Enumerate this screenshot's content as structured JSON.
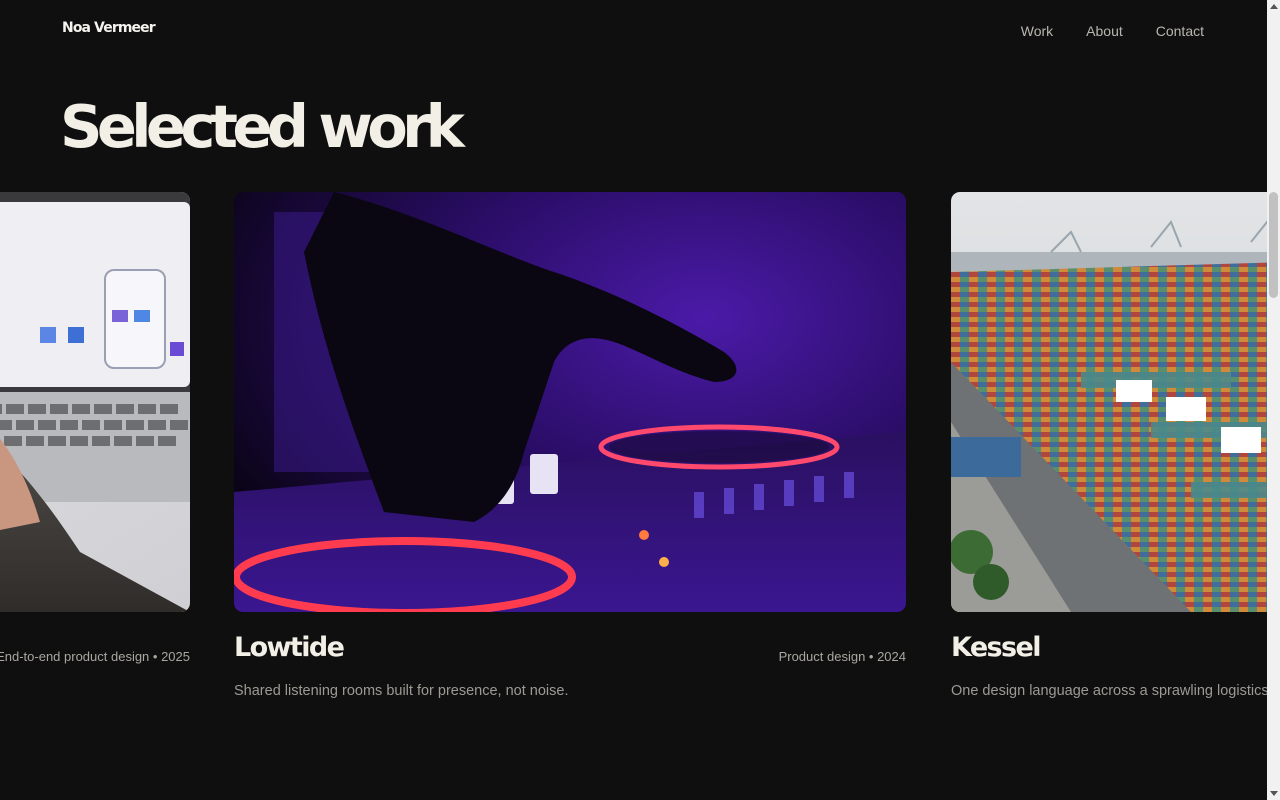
{
  "header": {
    "logo": "Noa Vermeer",
    "nav": [
      "Work",
      "About",
      "Contact"
    ]
  },
  "hero": {
    "title": "Selected work"
  },
  "projects": [
    {
      "title": "",
      "meta": "End-to-end product design • 2025",
      "description": "",
      "image": "laptop-with-mobile-app-mockup-photo"
    },
    {
      "title": "Lowtide",
      "meta": "Product design • 2024",
      "description": "Shared listening rooms built for presence, not noise.",
      "image": "dj-mixer-purple-light-photo"
    },
    {
      "title": "Kessel",
      "meta": "",
      "description": "One design language across a sprawling logistics platform.",
      "image": "aerial-container-port-photo"
    }
  ],
  "colors": {
    "background": "#0f0f0f",
    "text": "#f2efe7",
    "muted": "#a9a6a0",
    "accent_purple": "#6a2bd8",
    "accent_pink": "#ff3b6b"
  }
}
